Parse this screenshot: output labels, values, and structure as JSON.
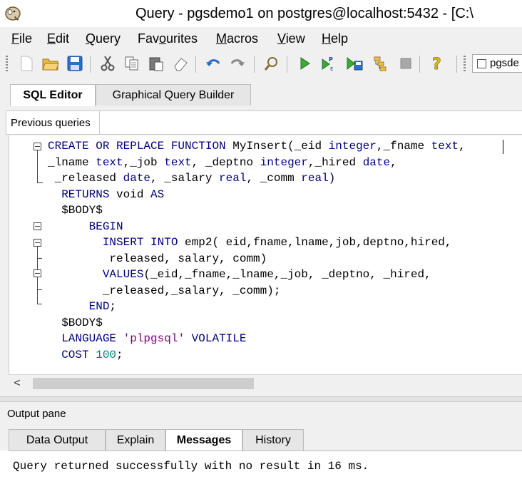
{
  "window": {
    "title": "Query - pgsdemo1 on postgres@localhost:5432 - [C:\\"
  },
  "menu": [
    {
      "label": "File",
      "mnemonic": "F",
      "rest": "ile"
    },
    {
      "label": "Edit",
      "mnemonic": "E",
      "rest": "dit"
    },
    {
      "label": "Query",
      "mnemonic": "Q",
      "rest": "uery"
    },
    {
      "label": "Favourites",
      "pre": "Fav",
      "mnemonic": "o",
      "rest": "urites"
    },
    {
      "label": "Macros",
      "mnemonic": "M",
      "rest": "acros"
    },
    {
      "label": "View",
      "mnemonic": "V",
      "rest": "iew"
    },
    {
      "label": "Help",
      "mnemonic": "H",
      "rest": "elp"
    }
  ],
  "toolbar": {
    "buttons": [
      "new-file-icon",
      "open-folder-icon",
      "save-icon",
      "cut-icon",
      "copy-icon",
      "paste-icon",
      "clear-eraser-icon",
      "undo-icon",
      "redo-icon",
      "find-icon",
      "execute-icon",
      "explain-icon",
      "execute-to-file-icon",
      "explain-analyze-icon",
      "stop-icon",
      "help-icon"
    ],
    "database_selector": "pgsde"
  },
  "editor_tabs": [
    "SQL Editor",
    "Graphical Query Builder"
  ],
  "active_editor_tab": "SQL Editor",
  "previous_queries_label": "Previous queries",
  "code_lines": [
    "CREATE OR REPLACE FUNCTION MyInsert(_eid integer,_fname text,",
    "_lname text,_job text, _deptno integer,_hired date,",
    " _released date, _salary real, _comm real)",
    "  RETURNS void AS",
    "  $BODY$",
    "      BEGIN",
    "        INSERT INTO emp2( eid,fname,lname,job,deptno,hired,",
    "         released, salary, comm)",
    "        VALUES(_eid,_fname,_lname,_job, _deptno, _hired,",
    "        _released,_salary, _comm);",
    "      END;",
    "  $BODY$",
    "  LANGUAGE 'plpgsql' VOLATILE",
    "  COST 100;"
  ],
  "output": {
    "pane_label": "Output pane",
    "tabs": [
      "Data Output",
      "Explain",
      "Messages",
      "History"
    ],
    "active_tab": "Messages",
    "message": "Query returned successfully with no result in 16 ms."
  },
  "colors": {
    "keyword": "#00007f",
    "string": "#7f007f",
    "number": "#007f7f",
    "chrome": "#f0f0f0"
  }
}
